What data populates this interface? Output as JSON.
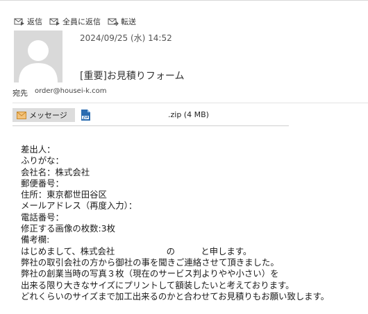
{
  "toolbar": {
    "reply_label": "返信",
    "reply_all_label": "全員に返信",
    "forward_label": "転送"
  },
  "header": {
    "datetime": "2024/09/25 (水) 14:52",
    "subject": "[重要]お見積りフォーム",
    "to_label": "宛先",
    "to_address": "order@housei-k.com"
  },
  "attachments": {
    "message_tab": "メッセージ",
    "file_name": ".zip (4 MB)"
  },
  "body": {
    "lines": [
      "差出人：",
      "ふりがな：",
      "会社名：株式会社",
      "郵便番号：",
      "住所：東京都世田谷区",
      "メールアドレス（再度入力）：",
      "電話番号：",
      "修正する画像の枚数:3枚",
      "備考欄:",
      "はじめまして、株式会社　　　　　　の　　　と申します。",
      "弊社の取引会社の方から御社の事を聞きご連絡させて頂きました。",
      "弊社の創業当時の写真３枚（現在のサービス判よりやや小さい）を",
      "出来る限り大きなサイズにプリントして額装したいと考えております。",
      "どれくらいのサイズまで加工出来るのかと合わせてお見積りもお願い致します。"
    ]
  },
  "colors": {
    "avatar_bg": "#d9d9d9",
    "tab_bg": "#dcdcdc",
    "icon_blue": "#2b6cb0",
    "envelope_orange": "#e8a046"
  }
}
